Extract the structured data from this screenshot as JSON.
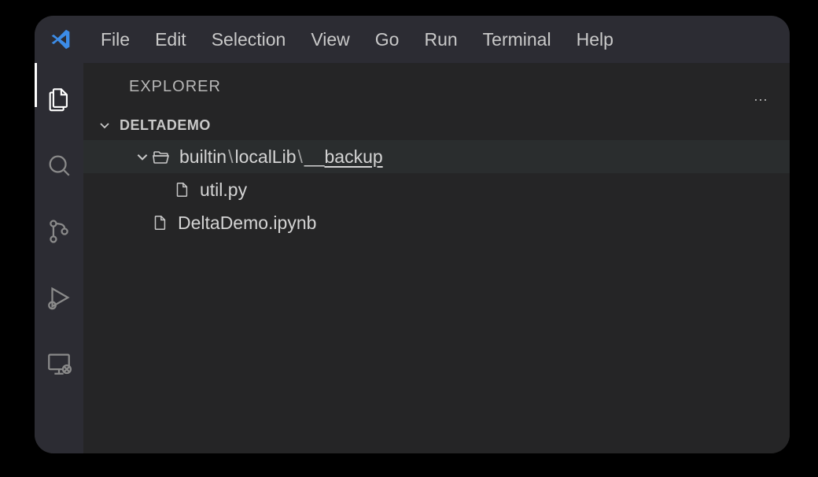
{
  "menu": {
    "file": "File",
    "edit": "Edit",
    "selection": "Selection",
    "view": "View",
    "go": "Go",
    "run": "Run",
    "terminal": "Terminal",
    "help": "Help"
  },
  "sidebar": {
    "title": "EXPLORER",
    "actions": "···"
  },
  "workspace": {
    "name": "DELTADEMO"
  },
  "tree": {
    "folder": {
      "seg1": "builtin",
      "sep": "\\",
      "seg2": "localLib",
      "seg3_prefix": "__",
      "seg3_name": "backup"
    },
    "files": {
      "f1": "util.py",
      "f2": "DeltaDemo.ipynb"
    }
  },
  "colors": {
    "accent": "#0098ff"
  }
}
